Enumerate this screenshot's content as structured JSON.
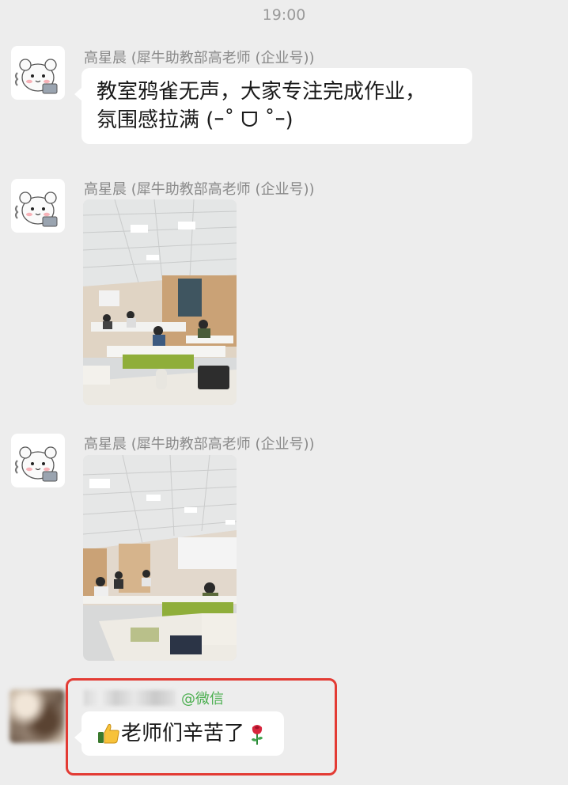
{
  "timestamp": "19:00",
  "messages": [
    {
      "sender": "高星晨 (犀牛助教部高老师 (企业号))",
      "text_line1": "教室鸦雀无声，大家专注完成作业，",
      "text_line2": "氛围感拉满 (ｰ˚ ᗜ ˚ｰ)"
    },
    {
      "sender": "高星晨 (犀牛助教部高老师 (企业号))",
      "image": "classroom-photo-1"
    },
    {
      "sender": "高星晨 (犀牛助教部高老师 (企业号))",
      "image": "classroom-photo-2"
    },
    {
      "sender_tag": "@微信",
      "text": "老师们辛苦了",
      "leading_emoji": "thumbs-up",
      "trailing_emoji": "rose"
    }
  ],
  "colors": {
    "background": "#ededed",
    "bubble": "#ffffff",
    "highlight": "#e33b34",
    "wechat_tag": "#4caf50"
  }
}
